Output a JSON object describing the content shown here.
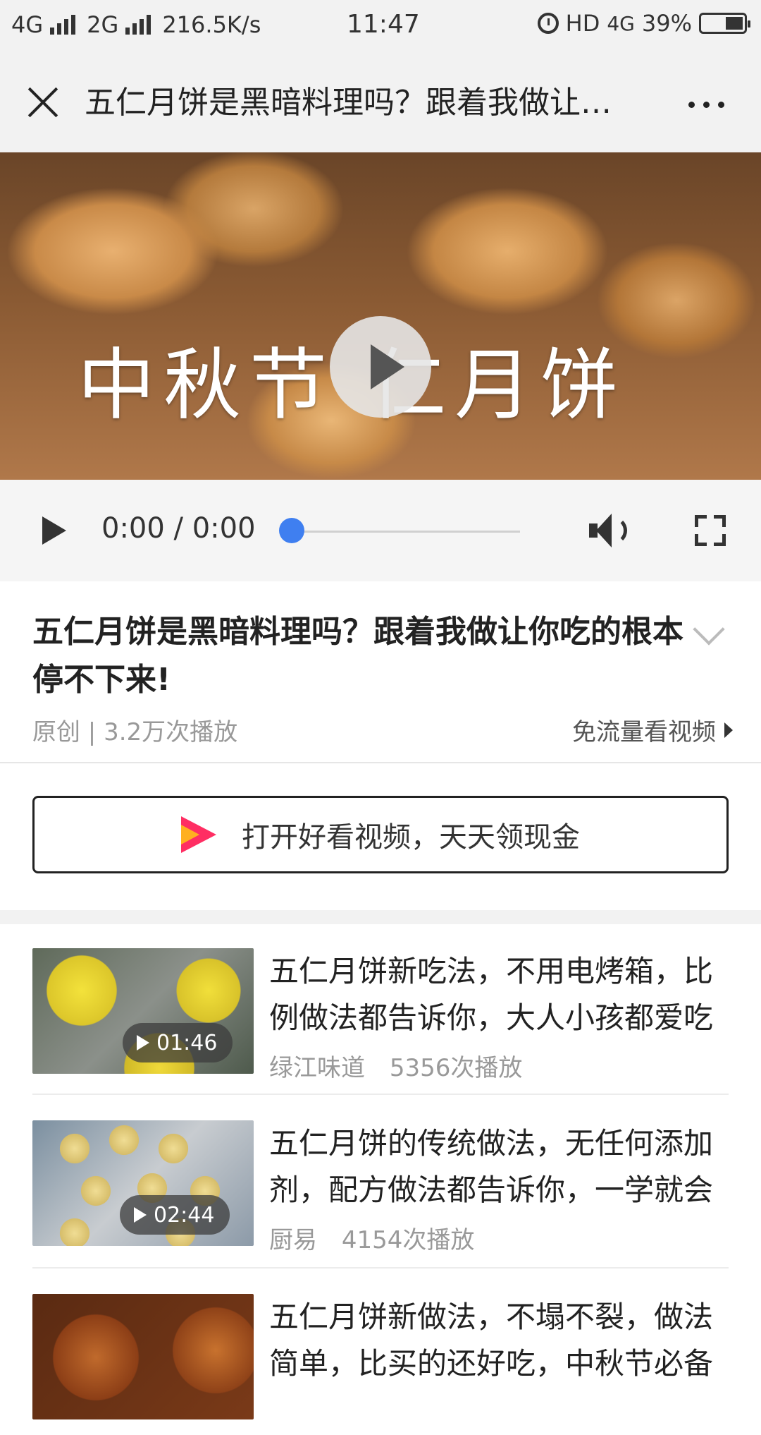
{
  "status_bar": {
    "network1": "4G",
    "network2": "2G",
    "speed": "216.5K/s",
    "time": "11:47",
    "hd": "HD",
    "net4g": "4G",
    "battery": "39%"
  },
  "navbar": {
    "title": "五仁月饼是黑暗料理吗？跟着我做让你吃的根本停不下来！"
  },
  "video": {
    "overlay_text": "中秋节 仁月饼"
  },
  "controls": {
    "time": "0:00 / 0:00",
    "progress": 0
  },
  "details": {
    "title": "五仁月饼是黑暗料理吗？跟着我做让你吃的根本停不下来!",
    "meta": "原创 | 3.2万次播放",
    "free_flow": "免流量看视频"
  },
  "app_banner": {
    "text": "打开好看视频，天天领现金"
  },
  "related": [
    {
      "title": "五仁月饼新吃法，不用电烤箱，比例做法都告诉你，大人小孩都爱吃",
      "author": "绿江味道",
      "plays": "5356次播放",
      "duration": "01:46"
    },
    {
      "title": "五仁月饼的传统做法，无任何添加剂，配方做法都告诉你，一学就会",
      "author": "厨易",
      "plays": "4154次播放",
      "duration": "02:44"
    },
    {
      "title": "五仁月饼新做法，不塌不裂，做法简单，比买的还好吃，中秋节必备",
      "author": "",
      "plays": "",
      "duration": ""
    }
  ]
}
